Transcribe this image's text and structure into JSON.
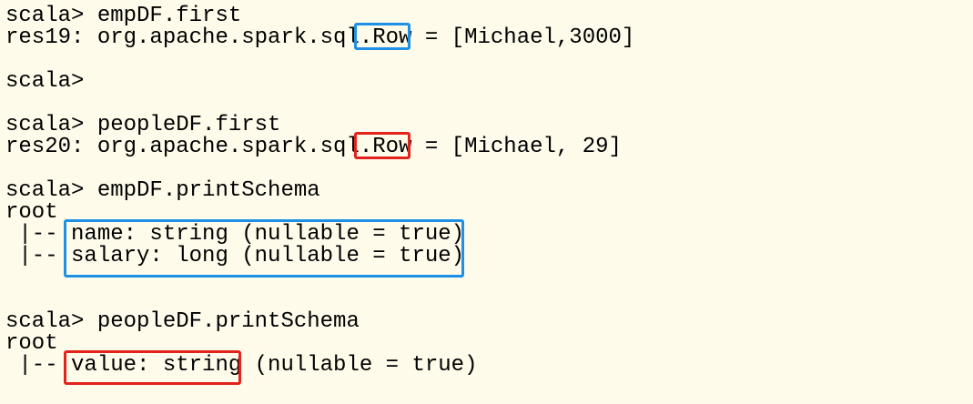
{
  "terminal": {
    "lines": [
      {
        "text": "scala> empDF.first"
      },
      {
        "text": "res19: org.apache.spark.sql.Row = [Michael,3000]"
      },
      {
        "text": ""
      },
      {
        "text": "scala>"
      },
      {
        "text": ""
      },
      {
        "text": "scala> peopleDF.first"
      },
      {
        "text": "res20: org.apache.spark.sql.Row = [Michael, 29]"
      },
      {
        "text": ""
      },
      {
        "text": "scala> empDF.printSchema"
      },
      {
        "text": "root"
      },
      {
        "text": " |-- name: string (nullable = true)"
      },
      {
        "text": " |-- salary: long (nullable = true)"
      },
      {
        "text": ""
      },
      {
        "text": ""
      },
      {
        "text": "scala> peopleDF.printSchema"
      },
      {
        "text": "root"
      },
      {
        "text": " |-- value: string (nullable = true)"
      }
    ]
  },
  "highlights": {
    "colors": {
      "blue": "#1e90e6",
      "red": "#e4221c"
    },
    "items": [
      {
        "name": "res19-row-type-highlight",
        "color": "blue",
        "target": "Row"
      },
      {
        "name": "res20-row-type-highlight",
        "color": "red",
        "target": "Row"
      },
      {
        "name": "empdf-schema-fields-highlight",
        "color": "blue",
        "target": "name: string (nullable = true) / salary: long (nullable = true)"
      },
      {
        "name": "peopledf-schema-value-highlight",
        "color": "red",
        "target": "value: string"
      }
    ]
  }
}
